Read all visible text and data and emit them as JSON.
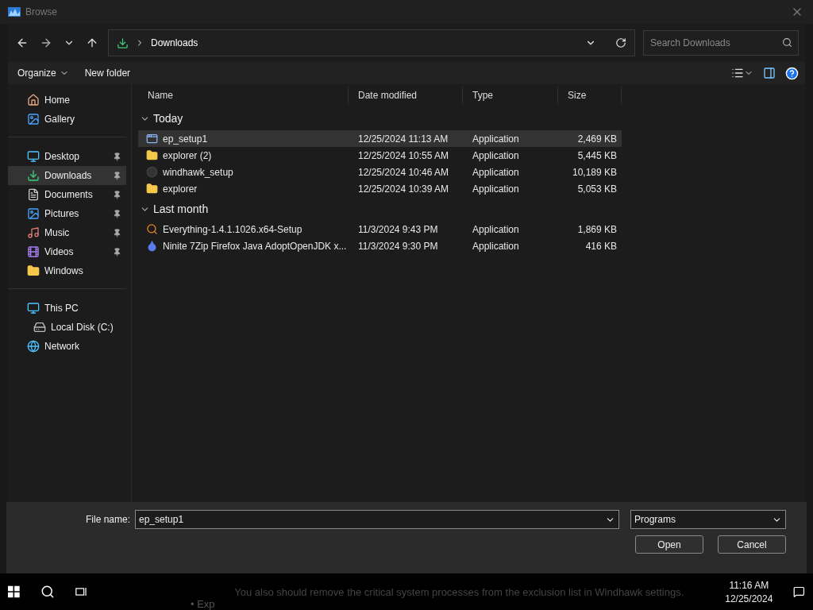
{
  "window": {
    "title": "Browse"
  },
  "address": {
    "path": "Downloads"
  },
  "search": {
    "placeholder": "Search Downloads"
  },
  "commands": {
    "organize": "Organize",
    "new_folder": "New folder"
  },
  "sidebar": {
    "groups": [
      {
        "items": [
          {
            "label": "Home",
            "kind": "home",
            "pinned": false,
            "selected": false
          },
          {
            "label": "Gallery",
            "kind": "gallery",
            "pinned": false,
            "selected": false
          }
        ]
      },
      {
        "items": [
          {
            "label": "Desktop",
            "kind": "desktop",
            "pinned": true,
            "selected": false
          },
          {
            "label": "Downloads",
            "kind": "download",
            "pinned": true,
            "selected": true
          },
          {
            "label": "Documents",
            "kind": "document",
            "pinned": true,
            "selected": false
          },
          {
            "label": "Pictures",
            "kind": "gallery",
            "pinned": true,
            "selected": false
          },
          {
            "label": "Music",
            "kind": "music",
            "pinned": true,
            "selected": false
          },
          {
            "label": "Videos",
            "kind": "video",
            "pinned": true,
            "selected": false
          },
          {
            "label": "Windows",
            "kind": "folder",
            "pinned": false,
            "selected": false
          }
        ]
      },
      {
        "items": [
          {
            "label": "This PC",
            "kind": "pc",
            "pinned": false,
            "selected": false,
            "children": [
              {
                "label": "Local Disk (C:)",
                "kind": "disk",
                "pinned": false,
                "selected": false
              }
            ]
          },
          {
            "label": "Network",
            "kind": "network",
            "pinned": false,
            "selected": false
          }
        ]
      }
    ]
  },
  "table": {
    "columns": [
      "Name",
      "Date modified",
      "Type",
      "Size"
    ],
    "groups": [
      {
        "label": "Today",
        "expanded": true,
        "rows": [
          {
            "name": "ep_setup1",
            "date": "12/25/2024 11:13 AM",
            "type": "Application",
            "size": "2,469 KB",
            "kind": "window",
            "selected": true
          },
          {
            "name": "explorer (2)",
            "date": "12/25/2024 10:55 AM",
            "type": "Application",
            "size": "5,445 KB",
            "kind": "folder",
            "selected": false
          },
          {
            "name": "windhawk_setup",
            "date": "12/25/2024 10:46 AM",
            "type": "Application",
            "size": "10,189 KB",
            "kind": "blank",
            "selected": false
          },
          {
            "name": "explorer",
            "date": "12/25/2024 10:39 AM",
            "type": "Application",
            "size": "5,053 KB",
            "kind": "folder",
            "selected": false
          }
        ]
      },
      {
        "label": "Last month",
        "expanded": true,
        "rows": [
          {
            "name": "Everything-1.4.1.1026.x64-Setup",
            "date": "11/3/2024 9:43 PM",
            "type": "Application",
            "size": "1,869 KB",
            "kind": "magnifier",
            "selected": false
          },
          {
            "name": "Ninite 7Zip Firefox Java AdoptOpenJDK x...",
            "date": "11/3/2024 9:30 PM",
            "type": "Application",
            "size": "416 KB",
            "kind": "drop",
            "selected": false
          }
        ]
      }
    ]
  },
  "footer": {
    "file_name_label": "File name:",
    "file_name": "ep_setup1",
    "filter": "Programs",
    "buttons": [
      "Open",
      "Cancel"
    ]
  },
  "background": {
    "sentence": "You also should remove the critical system processes from the exclusion list in Windhawk settings.",
    "bullet": "• Exp"
  },
  "taskbar": {
    "time": "11:16 AM",
    "date": "12/25/2024"
  }
}
